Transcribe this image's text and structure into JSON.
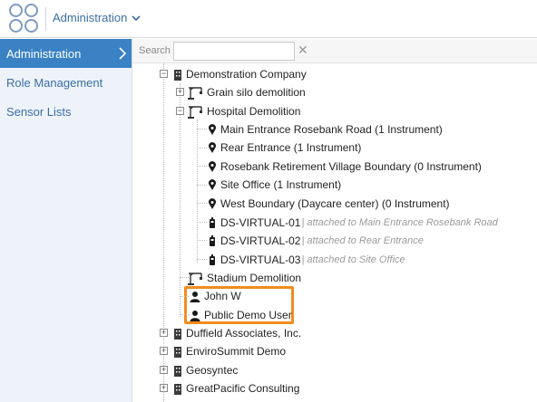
{
  "header": {
    "app_menu_label": "Administration"
  },
  "sidebar": {
    "items": [
      {
        "label": "Administration",
        "active": true
      },
      {
        "label": "Role Management",
        "active": false
      },
      {
        "label": "Sensor Lists",
        "active": false
      }
    ]
  },
  "search": {
    "label": "Search",
    "value": "",
    "placeholder": ""
  },
  "tree": {
    "root": "Demonstration Company",
    "projects": {
      "grain_silo": "Grain silo demolition",
      "hospital": "Hospital Demolition",
      "stadium": "Stadium Demolition"
    },
    "locations": [
      "Main Entrance Rosebank Road (1 Instrument)",
      "Rear Entrance (1 Instrument)",
      "Rosebank Retirement Village Boundary (0 Instrument)",
      "Site Office (1 Instrument)",
      "West Boundary (Daycare center) (0 Instrument)"
    ],
    "sensors": [
      {
        "name": "DS-VIRTUAL-01",
        "attached": "| attached to Main Entrance Rosebank Road"
      },
      {
        "name": "DS-VIRTUAL-02",
        "attached": "| attached to Rear Entrance"
      },
      {
        "name": "DS-VIRTUAL-03",
        "attached": "| attached to Site Office"
      }
    ],
    "users": [
      "John W",
      "Public Demo User"
    ],
    "companies": [
      "Duffield Associates, Inc.",
      "EnviroSummit Demo",
      "Geosyntec",
      "GreatPacific Consulting"
    ]
  },
  "colors": {
    "accent": "#3a82c4",
    "highlight": "#f28c1f",
    "link": "#3b6ea5"
  }
}
